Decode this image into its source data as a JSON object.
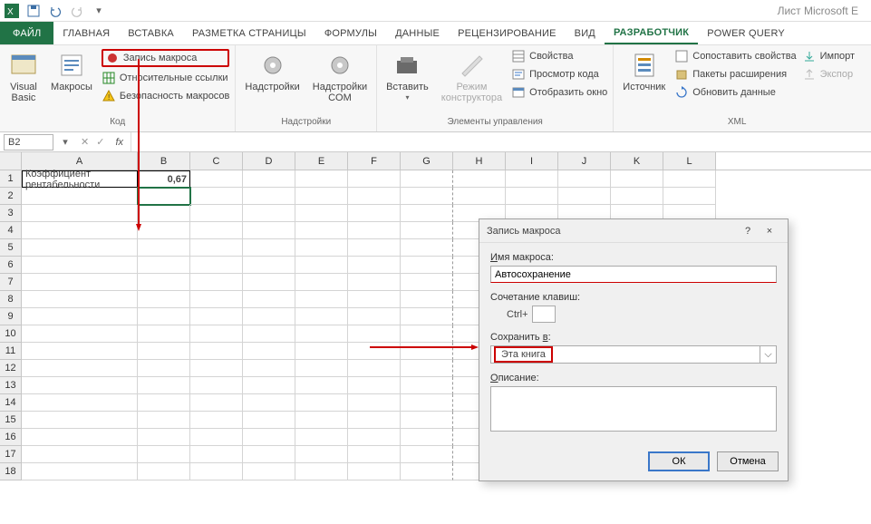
{
  "app_title": "Лист Microsoft E",
  "tabs": {
    "file": "ФАЙЛ",
    "home": "ГЛАВНАЯ",
    "insert": "ВСТАВКА",
    "layout": "РАЗМЕТКА СТРАНИЦЫ",
    "formulas": "ФОРМУЛЫ",
    "data": "ДАННЫЕ",
    "review": "РЕЦЕНЗИРОВАНИЕ",
    "view": "ВИД",
    "developer": "РАЗРАБОТЧИК",
    "powerquery": "POWER QUERY"
  },
  "ribbon": {
    "code": {
      "vb": "Visual\nBasic",
      "macros": "Макросы",
      "record": "Запись макроса",
      "relative": "Относительные ссылки",
      "security": "Безопасность макросов",
      "label": "Код"
    },
    "addins": {
      "addins": "Надстройки",
      "com": "Надстройки\nCOM",
      "label": "Надстройки"
    },
    "controls": {
      "insert": "Вставить",
      "design": "Режим\nконструктора",
      "props": "Свойства",
      "viewcode": "Просмотр кода",
      "showdlg": "Отобразить окно",
      "label": "Элементы управления"
    },
    "xml": {
      "source": "Источник",
      "mapprops": "Сопоставить свойства",
      "expansion": "Пакеты расширения",
      "refresh": "Обновить данные",
      "import": "Импорт",
      "export": "Экспор",
      "label": "XML"
    }
  },
  "namebox": "B2",
  "fx": "fx",
  "columns": [
    "A",
    "B",
    "C",
    "D",
    "E",
    "F",
    "G",
    "H",
    "I",
    "J",
    "K",
    "L"
  ],
  "rows": [
    "1",
    "2",
    "3",
    "4",
    "5",
    "6",
    "7",
    "8",
    "9",
    "10",
    "11",
    "12",
    "13",
    "14",
    "15",
    "16",
    "17",
    "18"
  ],
  "cells": {
    "A1": "Коэффициент рентабельности",
    "B1": "0,67"
  },
  "chart_data": {
    "type": "table",
    "columns": [
      "A",
      "B"
    ],
    "rows": [
      [
        "Коэффициент рентабельности",
        0.67
      ]
    ]
  },
  "dialog": {
    "title": "Запись макроса",
    "help": "?",
    "close": "×",
    "name_label": "Имя макроса:",
    "name_value": "Автосохранение",
    "shortcut_label": "Сочетание клавиш:",
    "shortcut_prefix": "Ctrl+",
    "savein_label": "Сохранить в:",
    "savein_value": "Эта книга",
    "desc_label": "Описание:",
    "ok": "ОК",
    "cancel": "Отмена"
  }
}
